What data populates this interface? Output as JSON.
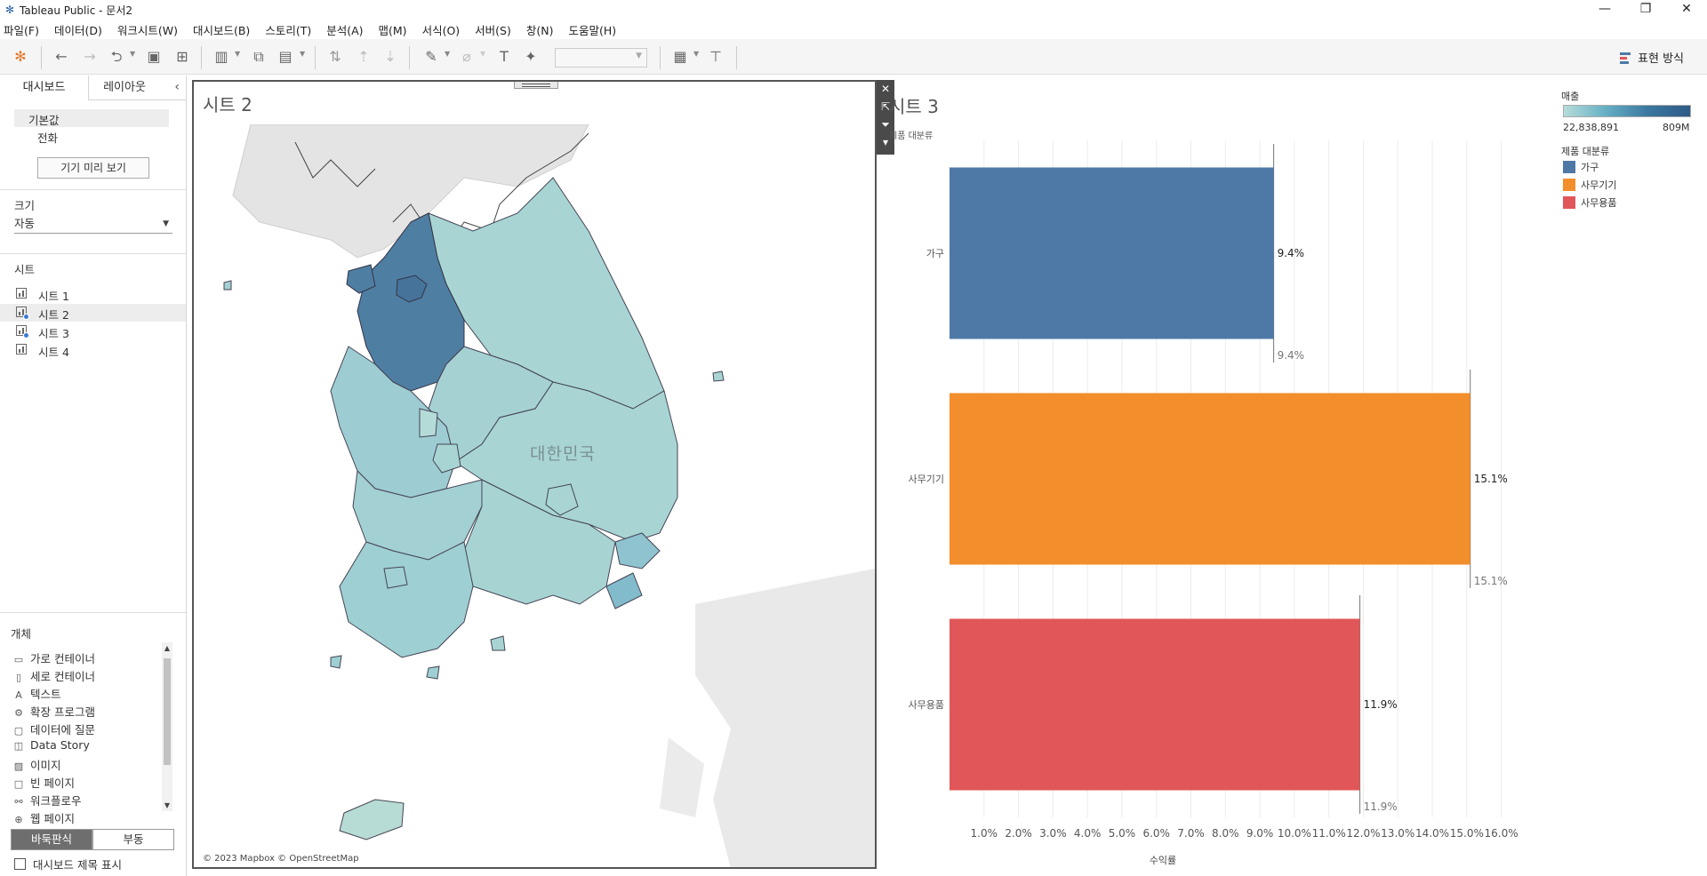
{
  "window": {
    "title": "Tableau Public - 문서2",
    "controls": [
      "—",
      "❐",
      "✕"
    ]
  },
  "menu": [
    "파일(F)",
    "데이터(D)",
    "워크시트(W)",
    "대시보드(B)",
    "스토리(T)",
    "분석(A)",
    "맵(M)",
    "서식(O)",
    "서버(S)",
    "창(N)",
    "도움말(H)"
  ],
  "toolbar": {
    "show_me_label": "표현 방식"
  },
  "left_panel": {
    "tabs": [
      "대시보드",
      "레이아웃"
    ],
    "device_section": {
      "items": [
        "기본값",
        "전화"
      ],
      "preview_button": "기기 미리 보기"
    },
    "size": {
      "header": "크기",
      "value": "자동"
    },
    "sheets": {
      "header": "시트",
      "items": [
        "시트 1",
        "시트 2",
        "시트 3",
        "시트 4"
      ]
    },
    "objects": {
      "header": "개체",
      "items": [
        {
          "label": "가로 컨테이너",
          "icon": "horizontal-container-icon"
        },
        {
          "label": "세로 컨테이너",
          "icon": "vertical-container-icon"
        },
        {
          "label": "텍스트",
          "icon": "text-icon"
        },
        {
          "label": "확장 프로그램",
          "icon": "extension-icon"
        },
        {
          "label": "데이터에 질문",
          "icon": "ask-data-icon"
        },
        {
          "label": "Data Story",
          "icon": "data-story-icon"
        },
        {
          "label": "이미지",
          "icon": "image-icon"
        },
        {
          "label": "빈 페이지",
          "icon": "blank-icon"
        },
        {
          "label": "워크플로우",
          "icon": "workflow-icon"
        },
        {
          "label": "웹 페이지",
          "icon": "web-page-icon"
        }
      ]
    },
    "tile_label": "바둑판식",
    "float_label": "부동",
    "show_title_label": "대시보드 제목 표시"
  },
  "sheet2": {
    "title": "시트 2",
    "country_label": "대한민국",
    "copyright": "© 2023 Mapbox © OpenStreetMap"
  },
  "sheet3": {
    "title": "시트 3",
    "row_header": "제품 대분류"
  },
  "legend": {
    "color_title": "매출",
    "color_min": "22,838,891",
    "color_max": "809M",
    "category_title": "제품 대분류",
    "categories": [
      {
        "label": "가구",
        "color": "#4e79a7"
      },
      {
        "label": "사무기기",
        "color": "#f28e2b"
      },
      {
        "label": "사무용품",
        "color": "#e15759"
      }
    ]
  },
  "chart_data": {
    "type": "bar",
    "orientation": "horizontal",
    "categories": [
      "가구",
      "사무기기",
      "사무용품"
    ],
    "values": [
      9.4,
      15.1,
      11.9
    ],
    "data_labels": [
      "9.4%",
      "15.1%",
      "11.9%"
    ],
    "colors": [
      "#4e79a7",
      "#f28e2b",
      "#e15759"
    ],
    "xlabel": "수익률",
    "ylabel": "제품 대분류",
    "xlim": [
      0,
      16.5
    ],
    "xticks": [
      "1.0%",
      "2.0%",
      "3.0%",
      "4.0%",
      "5.0%",
      "6.0%",
      "7.0%",
      "8.0%",
      "9.0%",
      "10.0%",
      "11.0%",
      "12.0%",
      "13.0%",
      "14.0%",
      "15.0%",
      "16.0%"
    ],
    "grid": "vertical"
  }
}
